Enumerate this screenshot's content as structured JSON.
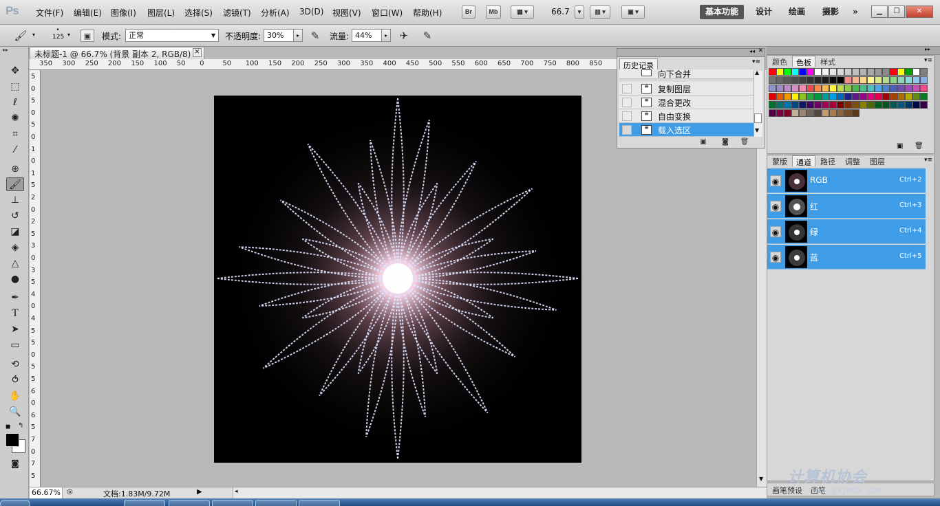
{
  "app": {
    "logo": "Ps"
  },
  "menu": [
    "文件(F)",
    "编辑(E)",
    "图像(I)",
    "图层(L)",
    "选择(S)",
    "滤镜(T)",
    "分析(A)",
    "3D(D)",
    "视图(V)",
    "窗口(W)",
    "帮助(H)"
  ],
  "app_bar": {
    "bridge": "Br",
    "minibridge": "Mb",
    "zoom": "66.7"
  },
  "workspaces": {
    "active": "基本功能",
    "items": [
      "设计",
      "绘画",
      "摄影"
    ],
    "more": "»"
  },
  "options": {
    "brush_size": "125",
    "mode_label": "模式:",
    "mode_value": "正常",
    "opacity_label": "不透明度:",
    "opacity_value": "30%",
    "flow_label": "流量:",
    "flow_value": "44%"
  },
  "document": {
    "tab_title": "未标题-1 @ 66.7% (背景 副本 2, RGB/8) *"
  },
  "rulers": {
    "h": [
      "350",
      "300",
      "250",
      "200",
      "150",
      "100",
      "50",
      "0",
      "50",
      "100",
      "150",
      "200",
      "250",
      "300",
      "350",
      "400",
      "450",
      "500",
      "550",
      "600",
      "650",
      "700",
      "750",
      "800",
      "850"
    ],
    "v": [
      "5",
      "0",
      "5",
      "0",
      "5",
      "0",
      "1",
      "0",
      "1",
      "5",
      "2",
      "0",
      "2",
      "5",
      "3",
      "0",
      "3",
      "5",
      "4",
      "0",
      "4",
      "5",
      "5",
      "0",
      "5",
      "5",
      "6",
      "0",
      "6",
      "5",
      "7",
      "0",
      "7",
      "5"
    ]
  },
  "status": {
    "zoom": "66.67%",
    "doc": "文档:1.83M/9.72M"
  },
  "history": {
    "tab": "历史记录",
    "items": [
      {
        "label": "向下合并",
        "selected": false
      },
      {
        "label": "复制图层",
        "selected": false
      },
      {
        "label": "混合更改",
        "selected": false
      },
      {
        "label": "自由变换",
        "selected": false
      },
      {
        "label": "载入选区",
        "selected": true
      }
    ]
  },
  "swatches": {
    "tabs": [
      "颜色",
      "色板",
      "样式"
    ],
    "active": "色板",
    "colors": [
      "#ff0000",
      "#ffff00",
      "#00ff00",
      "#00ffff",
      "#0000ff",
      "#ff00ff",
      "#ffffff",
      "#f2f2f2",
      "#e6e6e6",
      "#d9d9d9",
      "#cccccc",
      "#bfbfbf",
      "#b3b3b3",
      "#a6a6a6",
      "#999999",
      "#8c8c8c",
      "#ff0000",
      "#ffff00",
      "#00a000",
      "#ffffff",
      "#808080",
      "#737373",
      "#666666",
      "#595959",
      "#4d4d4d",
      "#404040",
      "#333333",
      "#262626",
      "#1a1a1a",
      "#0d0d0d",
      "#000000",
      "#f48c8c",
      "#f7b48c",
      "#fbd58c",
      "#fff78c",
      "#d6ea8c",
      "#b2dc8c",
      "#8cd48c",
      "#8cd5b4",
      "#8cd8db",
      "#8cc8f1",
      "#8caddf",
      "#8c95cb",
      "#a08cc8",
      "#bb8cc8",
      "#dd8cc8",
      "#f28caf",
      "#ee4c4c",
      "#f38a4c",
      "#f9b84c",
      "#fff34c",
      "#c0dc4c",
      "#8cc84c",
      "#4cba4c",
      "#4cbc8c",
      "#4cc2c6",
      "#4caaec",
      "#4c82d2",
      "#4c5eb8",
      "#744cb4",
      "#9c4cb4",
      "#cc4cb4",
      "#ee4c8c",
      "#e00000",
      "#ea5a00",
      "#f39800",
      "#fff100",
      "#8fc31f",
      "#22ac38",
      "#009944",
      "#009e96",
      "#00a0e9",
      "#0068b7",
      "#1d2088",
      "#601986",
      "#920783",
      "#e4007f",
      "#e5004f",
      "#a40000",
      "#a84200",
      "#ad6d00",
      "#b7aa00",
      "#638c0b",
      "#097c25",
      "#007130",
      "#00736d",
      "#0075a9",
      "#004986",
      "#101765",
      "#440062",
      "#6a005f",
      "#a40058",
      "#a40037",
      "#7d0000",
      "#7f2d00",
      "#824f00",
      "#8a8000",
      "#4a6a00",
      "#005e17",
      "#005420",
      "#005652",
      "#005780",
      "#003567",
      "#000b4d",
      "#330048",
      "#500045",
      "#7f0040",
      "#7e0026",
      "#c7b299",
      "#998675",
      "#736357",
      "#534741",
      "#c69c6d",
      "#a67c52",
      "#8c6239",
      "#754c24",
      "#603813"
    ]
  },
  "channels": {
    "tabs": [
      "蒙版",
      "通道",
      "路径",
      "调整",
      "图层"
    ],
    "active": "通道",
    "rows": [
      {
        "name": "RGB",
        "key": "Ctrl+2"
      },
      {
        "name": "红",
        "key": "Ctrl+3"
      },
      {
        "name": "绿",
        "key": "Ctrl+4"
      },
      {
        "name": "蓝",
        "key": "Ctrl+5"
      }
    ]
  },
  "brush_tabs": [
    "画笔预设",
    "画笔"
  ],
  "watermark": {
    "text": "计算机协会",
    "url": "www.gxjmca.com"
  }
}
